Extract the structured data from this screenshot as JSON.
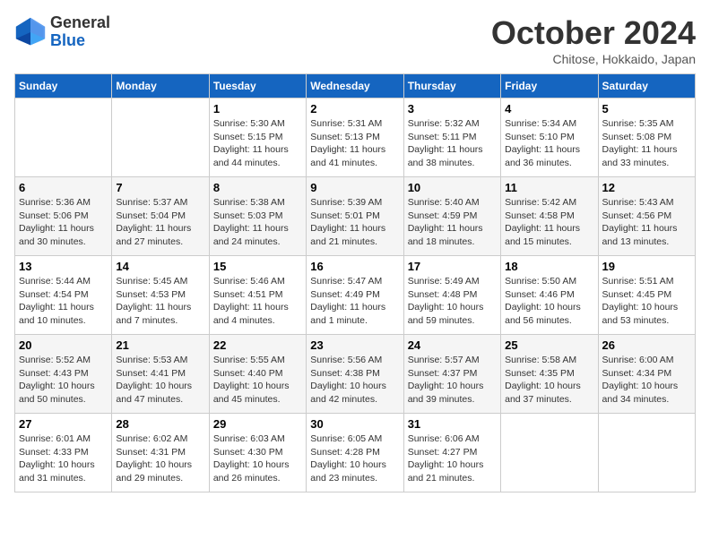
{
  "header": {
    "logo_line1": "General",
    "logo_line2": "Blue",
    "month": "October 2024",
    "location": "Chitose, Hokkaido, Japan"
  },
  "weekdays": [
    "Sunday",
    "Monday",
    "Tuesday",
    "Wednesday",
    "Thursday",
    "Friday",
    "Saturday"
  ],
  "weeks": [
    [
      {
        "day": "",
        "info": ""
      },
      {
        "day": "",
        "info": ""
      },
      {
        "day": "1",
        "info": "Sunrise: 5:30 AM\nSunset: 5:15 PM\nDaylight: 11 hours and 44 minutes."
      },
      {
        "day": "2",
        "info": "Sunrise: 5:31 AM\nSunset: 5:13 PM\nDaylight: 11 hours and 41 minutes."
      },
      {
        "day": "3",
        "info": "Sunrise: 5:32 AM\nSunset: 5:11 PM\nDaylight: 11 hours and 38 minutes."
      },
      {
        "day": "4",
        "info": "Sunrise: 5:34 AM\nSunset: 5:10 PM\nDaylight: 11 hours and 36 minutes."
      },
      {
        "day": "5",
        "info": "Sunrise: 5:35 AM\nSunset: 5:08 PM\nDaylight: 11 hours and 33 minutes."
      }
    ],
    [
      {
        "day": "6",
        "info": "Sunrise: 5:36 AM\nSunset: 5:06 PM\nDaylight: 11 hours and 30 minutes."
      },
      {
        "day": "7",
        "info": "Sunrise: 5:37 AM\nSunset: 5:04 PM\nDaylight: 11 hours and 27 minutes."
      },
      {
        "day": "8",
        "info": "Sunrise: 5:38 AM\nSunset: 5:03 PM\nDaylight: 11 hours and 24 minutes."
      },
      {
        "day": "9",
        "info": "Sunrise: 5:39 AM\nSunset: 5:01 PM\nDaylight: 11 hours and 21 minutes."
      },
      {
        "day": "10",
        "info": "Sunrise: 5:40 AM\nSunset: 4:59 PM\nDaylight: 11 hours and 18 minutes."
      },
      {
        "day": "11",
        "info": "Sunrise: 5:42 AM\nSunset: 4:58 PM\nDaylight: 11 hours and 15 minutes."
      },
      {
        "day": "12",
        "info": "Sunrise: 5:43 AM\nSunset: 4:56 PM\nDaylight: 11 hours and 13 minutes."
      }
    ],
    [
      {
        "day": "13",
        "info": "Sunrise: 5:44 AM\nSunset: 4:54 PM\nDaylight: 11 hours and 10 minutes."
      },
      {
        "day": "14",
        "info": "Sunrise: 5:45 AM\nSunset: 4:53 PM\nDaylight: 11 hours and 7 minutes."
      },
      {
        "day": "15",
        "info": "Sunrise: 5:46 AM\nSunset: 4:51 PM\nDaylight: 11 hours and 4 minutes."
      },
      {
        "day": "16",
        "info": "Sunrise: 5:47 AM\nSunset: 4:49 PM\nDaylight: 11 hours and 1 minute."
      },
      {
        "day": "17",
        "info": "Sunrise: 5:49 AM\nSunset: 4:48 PM\nDaylight: 10 hours and 59 minutes."
      },
      {
        "day": "18",
        "info": "Sunrise: 5:50 AM\nSunset: 4:46 PM\nDaylight: 10 hours and 56 minutes."
      },
      {
        "day": "19",
        "info": "Sunrise: 5:51 AM\nSunset: 4:45 PM\nDaylight: 10 hours and 53 minutes."
      }
    ],
    [
      {
        "day": "20",
        "info": "Sunrise: 5:52 AM\nSunset: 4:43 PM\nDaylight: 10 hours and 50 minutes."
      },
      {
        "day": "21",
        "info": "Sunrise: 5:53 AM\nSunset: 4:41 PM\nDaylight: 10 hours and 47 minutes."
      },
      {
        "day": "22",
        "info": "Sunrise: 5:55 AM\nSunset: 4:40 PM\nDaylight: 10 hours and 45 minutes."
      },
      {
        "day": "23",
        "info": "Sunrise: 5:56 AM\nSunset: 4:38 PM\nDaylight: 10 hours and 42 minutes."
      },
      {
        "day": "24",
        "info": "Sunrise: 5:57 AM\nSunset: 4:37 PM\nDaylight: 10 hours and 39 minutes."
      },
      {
        "day": "25",
        "info": "Sunrise: 5:58 AM\nSunset: 4:35 PM\nDaylight: 10 hours and 37 minutes."
      },
      {
        "day": "26",
        "info": "Sunrise: 6:00 AM\nSunset: 4:34 PM\nDaylight: 10 hours and 34 minutes."
      }
    ],
    [
      {
        "day": "27",
        "info": "Sunrise: 6:01 AM\nSunset: 4:33 PM\nDaylight: 10 hours and 31 minutes."
      },
      {
        "day": "28",
        "info": "Sunrise: 6:02 AM\nSunset: 4:31 PM\nDaylight: 10 hours and 29 minutes."
      },
      {
        "day": "29",
        "info": "Sunrise: 6:03 AM\nSunset: 4:30 PM\nDaylight: 10 hours and 26 minutes."
      },
      {
        "day": "30",
        "info": "Sunrise: 6:05 AM\nSunset: 4:28 PM\nDaylight: 10 hours and 23 minutes."
      },
      {
        "day": "31",
        "info": "Sunrise: 6:06 AM\nSunset: 4:27 PM\nDaylight: 10 hours and 21 minutes."
      },
      {
        "day": "",
        "info": ""
      },
      {
        "day": "",
        "info": ""
      }
    ]
  ]
}
